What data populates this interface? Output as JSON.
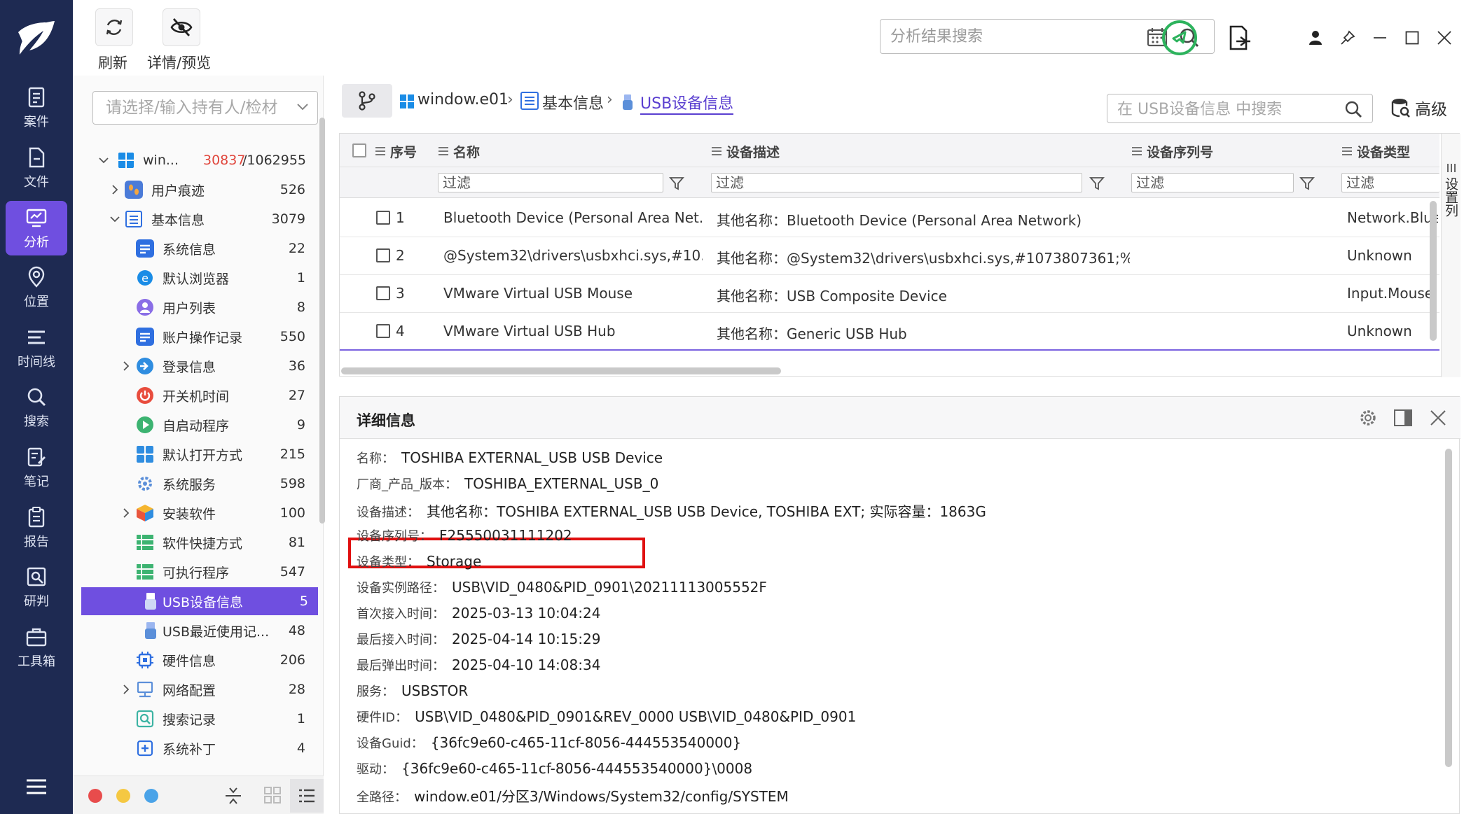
{
  "toolbar": {
    "refresh_label": "刷新",
    "details_preview_label": "详情/预览",
    "search_placeholder": "分析结果搜索"
  },
  "nav": {
    "items": [
      {
        "label": "案件",
        "icon": "case-icon"
      },
      {
        "label": "文件",
        "icon": "file-icon"
      },
      {
        "label": "分析",
        "icon": "analysis-icon",
        "active": true
      },
      {
        "label": "位置",
        "icon": "location-icon"
      },
      {
        "label": "时间线",
        "icon": "timeline-icon"
      },
      {
        "label": "搜索",
        "icon": "search-icon"
      },
      {
        "label": "笔记",
        "icon": "note-icon"
      },
      {
        "label": "报告",
        "icon": "report-icon"
      },
      {
        "label": "研判",
        "icon": "judge-icon"
      },
      {
        "label": "工具箱",
        "icon": "toolbox-icon"
      }
    ]
  },
  "tree": {
    "search_placeholder": "请选择/输入持有人/检材",
    "root": {
      "label": "win...",
      "highlight_count": "30837",
      "total": "/1062955"
    },
    "items": [
      {
        "label": "用户痕迹",
        "count": "526"
      },
      {
        "label": "基本信息",
        "count": "3079"
      },
      {
        "label": "系统信息",
        "count": "22"
      },
      {
        "label": "默认浏览器",
        "count": "1"
      },
      {
        "label": "用户列表",
        "count": "8"
      },
      {
        "label": "账户操作记录",
        "count": "550"
      },
      {
        "label": "登录信息",
        "count": "36"
      },
      {
        "label": "开关机时间",
        "count": "27"
      },
      {
        "label": "自启动程序",
        "count": "9"
      },
      {
        "label": "默认打开方式",
        "count": "215"
      },
      {
        "label": "系统服务",
        "count": "598"
      },
      {
        "label": "安装软件",
        "count": "100"
      },
      {
        "label": "软件快捷方式",
        "count": "81"
      },
      {
        "label": "可执行程序",
        "count": "547"
      },
      {
        "label": "USB设备信息",
        "count": "5"
      },
      {
        "label": "USB最近使用记...",
        "count": "48"
      },
      {
        "label": "硬件信息",
        "count": "206"
      },
      {
        "label": "网络配置",
        "count": "28"
      },
      {
        "label": "搜索记录",
        "count": "1"
      },
      {
        "label": "系统补丁",
        "count": "4"
      }
    ]
  },
  "breadcrumb": {
    "items": [
      "window.e01",
      "基本信息",
      "USB设备信息"
    ],
    "search_placeholder": "在 USB设备信息 中搜索",
    "advanced_label": "高级"
  },
  "grid": {
    "columns": [
      "序号",
      "名称",
      "设备描述",
      "设备序列号",
      "设备类型"
    ],
    "filter_placeholder": "过滤",
    "side_label": "设置列",
    "rows": [
      {
        "no": "1",
        "name": "Bluetooth Device (Personal Area Net...",
        "desc": "其他名称：Bluetooth Device (Personal Area Network)",
        "serial": "",
        "type": "Network.Blue"
      },
      {
        "no": "2",
        "name": "@System32\\drivers\\usbxhci.sys,#10...",
        "desc": "其他名称：@System32\\drivers\\usbxhci.sys,#1073807361;%...",
        "serial": "",
        "type": "Unknown"
      },
      {
        "no": "3",
        "name": "VMware Virtual USB Mouse",
        "desc": "其他名称：USB Composite Device",
        "serial": "",
        "type": "Input.Mouse"
      },
      {
        "no": "4",
        "name": "VMware Virtual USB Hub",
        "desc": "其他名称：Generic USB Hub",
        "serial": "",
        "type": "Unknown"
      }
    ]
  },
  "details": {
    "title": "详细信息",
    "fields": [
      {
        "k": "名称：",
        "v": "TOSHIBA EXTERNAL_USB USB Device"
      },
      {
        "k": "厂商_产品_版本：",
        "v": "TOSHIBA_EXTERNAL_USB_0"
      },
      {
        "k": "设备描述：",
        "v": "其他名称：TOSHIBA EXTERNAL_USB USB Device, TOSHIBA EXT; 实际容量：1863G"
      },
      {
        "k": "设备序列号：",
        "v": "F25550031111202"
      },
      {
        "k": "设备类型：",
        "v": "Storage"
      },
      {
        "k": "设备实例路径：",
        "v": "USB\\VID_0480&PID_0901\\20211113005552F"
      },
      {
        "k": "首次接入时间：",
        "v": "2025-03-13 10:04:24"
      },
      {
        "k": "最后接入时间：",
        "v": "2025-04-14 10:15:29"
      },
      {
        "k": "最后弹出时间：",
        "v": "2025-04-10 14:08:34"
      },
      {
        "k": "服务：",
        "v": "USBSTOR"
      },
      {
        "k": "硬件ID：",
        "v": "USB\\VID_0480&PID_0901&REV_0000 USB\\VID_0480&PID_0901"
      },
      {
        "k": "设备Guid：",
        "v": "{36fc9e60-c465-11cf-8056-444553540000}"
      },
      {
        "k": "驱动：",
        "v": "{36fc9e60-c465-11cf-8056-444553540000}\\0008"
      },
      {
        "k": "全路径：",
        "v": "window.e01/分区3/Windows/System32/config/SYSTEM"
      }
    ]
  },
  "colors": {
    "nav_bg": "#1e2a52",
    "accent": "#6f4fe0",
    "highlight": "#e01010",
    "count_red": "#e0463c"
  }
}
